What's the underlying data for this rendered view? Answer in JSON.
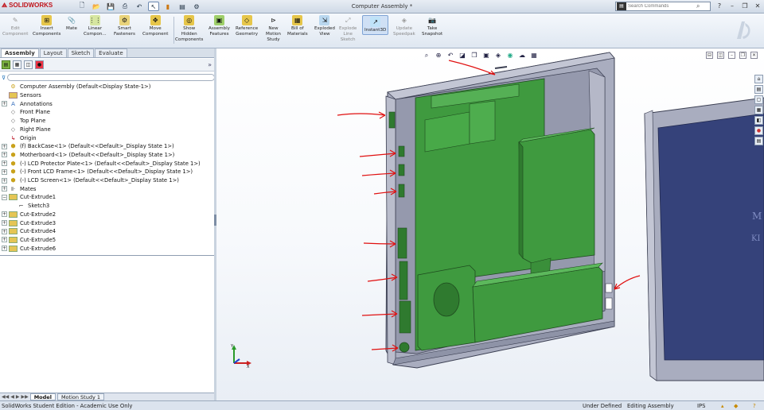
{
  "app": {
    "logo_text": "SOLIDWORKS",
    "title": "Computer Assembly *",
    "search_placeholder": "Search Commands",
    "help_label": "?"
  },
  "quick_access": [
    "new-icon",
    "open-icon",
    "save-icon",
    "print-icon",
    "undo-icon",
    "select-icon",
    "rebuild-icon",
    "file-props-icon",
    "options-icon"
  ],
  "commands": [
    {
      "key": "edit",
      "label": "Edit\nComponent",
      "icon": "edit-component-icon",
      "dim": true
    },
    {
      "key": "insert",
      "label": "Insert\nComponents",
      "icon": "insert-components-icon",
      "dim": false
    },
    {
      "key": "mate",
      "label": "Mate",
      "icon": "mate-icon",
      "dim": false
    },
    {
      "key": "linear",
      "label": "Linear\nCompon...",
      "icon": "linear-pattern-icon",
      "dim": false
    },
    {
      "key": "smart",
      "label": "Smart\nFasteners",
      "icon": "smart-fasteners-icon",
      "dim": false
    },
    {
      "key": "move",
      "label": "Move\nComponent",
      "icon": "move-component-icon",
      "dim": false
    },
    {
      "key": "show",
      "label": "Show\nHidden\nComponents",
      "icon": "show-hidden-icon",
      "dim": false
    },
    {
      "key": "assyfeat",
      "label": "Assembly\nFeatures",
      "icon": "assembly-features-icon",
      "dim": false
    },
    {
      "key": "refgeom",
      "label": "Reference\nGeometry",
      "icon": "reference-geometry-icon",
      "dim": false
    },
    {
      "key": "motion",
      "label": "New\nMotion\nStudy",
      "icon": "motion-study-icon",
      "dim": false
    },
    {
      "key": "bom",
      "label": "Bill of\nMaterials",
      "icon": "bill-of-materials-icon",
      "dim": false
    },
    {
      "key": "exploded",
      "label": "Exploded\nView",
      "icon": "exploded-view-icon",
      "dim": false
    },
    {
      "key": "explodeline",
      "label": "Explode\nLine\nSketch",
      "icon": "explode-line-icon",
      "dim": true
    },
    {
      "key": "instant3d",
      "label": "Instant3D",
      "icon": "instant3d-icon",
      "dim": false
    },
    {
      "key": "speedpak",
      "label": "Update\nSpeedpak",
      "icon": "speedpak-icon",
      "dim": true
    },
    {
      "key": "snapshot",
      "label": "Take\nSnapshot",
      "icon": "snapshot-icon",
      "dim": false
    }
  ],
  "left_tabs": [
    "Assembly",
    "Layout",
    "Sketch",
    "Evaluate"
  ],
  "tree": [
    {
      "label": "Computer Assembly  (Default<Display State-1>)",
      "icon": "assembly-icon",
      "expander": "",
      "indent": 0
    },
    {
      "label": "Sensors",
      "icon": "sensors-icon",
      "expander": "",
      "indent": 1
    },
    {
      "label": "Annotations",
      "icon": "annotations-icon",
      "expander": "+",
      "indent": 1
    },
    {
      "label": "Front Plane",
      "icon": "plane-icon",
      "expander": "",
      "indent": 1
    },
    {
      "label": "Top Plane",
      "icon": "plane-icon",
      "expander": "",
      "indent": 1
    },
    {
      "label": "Right Plane",
      "icon": "plane-icon",
      "expander": "",
      "indent": 1
    },
    {
      "label": "Origin",
      "icon": "origin-icon",
      "expander": "",
      "indent": 1
    },
    {
      "label": "(f) BackCase<1> (Default<<Default>_Display State 1>)",
      "icon": "part-icon",
      "expander": "+",
      "indent": 1
    },
    {
      "label": "Motherboard<1> (Default<<Default>_Display State 1>)",
      "icon": "part-icon",
      "expander": "+",
      "indent": 1
    },
    {
      "label": "(-) LCD Protector Plate<1> (Default<<Default>_Display State 1>)",
      "icon": "part-icon",
      "expander": "+",
      "indent": 1
    },
    {
      "label": "(-) Front LCD Frame<1> (Default<<Default>_Display State 1>)",
      "icon": "part-icon",
      "expander": "+",
      "indent": 1
    },
    {
      "label": "(-) LCD Screen<1> (Default<<Default>_Display State 1>)",
      "icon": "part-icon",
      "expander": "+",
      "indent": 1
    },
    {
      "label": "Mates",
      "icon": "mates-icon",
      "expander": "+",
      "indent": 1
    },
    {
      "label": "Cut-Extrude1",
      "icon": "cut-extrude-icon",
      "expander": "-",
      "indent": 1
    },
    {
      "label": "Sketch3",
      "icon": "sketch-icon",
      "expander": "",
      "indent": 2
    },
    {
      "label": "Cut-Extrude2",
      "icon": "cut-extrude-icon",
      "expander": "+",
      "indent": 1
    },
    {
      "label": "Cut-Extrude3",
      "icon": "cut-extrude-icon",
      "expander": "+",
      "indent": 1
    },
    {
      "label": "Cut-Extrude4",
      "icon": "cut-extrude-icon",
      "expander": "+",
      "indent": 1
    },
    {
      "label": "Cut-Extrude5",
      "icon": "cut-extrude-icon",
      "expander": "+",
      "indent": 1
    },
    {
      "label": "Cut-Extrude6",
      "icon": "cut-extrude-icon",
      "expander": "+",
      "indent": 1
    }
  ],
  "bottom_tabs": [
    "Model",
    "Motion Study 1"
  ],
  "status": {
    "left": "SolidWorks Student Edition - Academic Use Only",
    "definition": "Under Defined",
    "mode": "Editing Assembly",
    "units": "IPS"
  },
  "colors": {
    "pcb_green": "#3f9a3f",
    "case_gray": "#a7abbe",
    "annotation_red": "#e01010",
    "screen_blue": "#35427a"
  }
}
